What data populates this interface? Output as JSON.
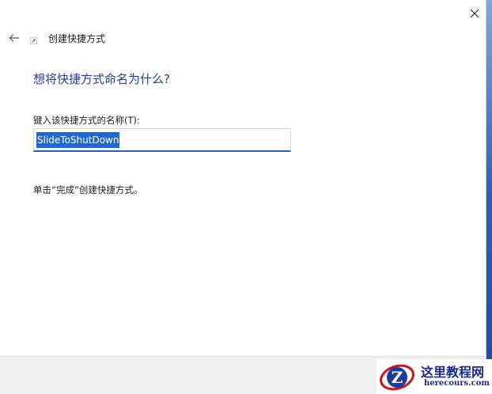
{
  "dialog": {
    "header_title": "创建快捷方式",
    "heading": "想将快捷方式命名为什么?",
    "field_label": "键入该快捷方式的名称(T):",
    "name_value": "SlideToShutDown",
    "instruction": "单击“完成”创建快捷方式。"
  },
  "icons": {
    "close": "close-icon",
    "back": "back-arrow-icon",
    "shortcut": "shortcut-arrow-icon"
  },
  "colors": {
    "heading": "#1f3f8c",
    "selection": "#1f68d3",
    "input_underline": "#1f63c4"
  },
  "watermark": {
    "title": "这里教程网",
    "url": "herecours.com",
    "logo_letter": "Z"
  }
}
